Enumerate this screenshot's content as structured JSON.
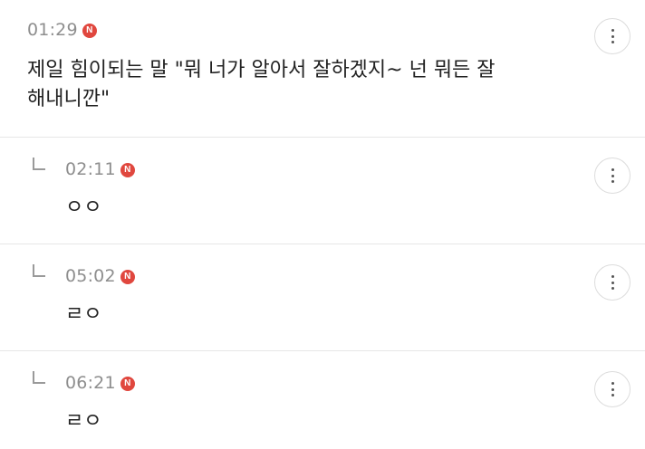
{
  "comments": [
    {
      "time": "01:29",
      "badge": "N",
      "text_line1": "제일 힘이되는 말 \"뭐 너가 알아서 잘하겠지~ 넌 뭐든 잘",
      "text_line2": "해내니깐\"",
      "is_reply": false
    },
    {
      "time": "02:11",
      "badge": "N",
      "text": "ㅇㅇ",
      "is_reply": true
    },
    {
      "time": "05:02",
      "badge": "N",
      "text": "ㄹㅇ",
      "is_reply": true
    },
    {
      "time": "06:21",
      "badge": "N",
      "text": "ㄹㅇ",
      "is_reply": true
    }
  ],
  "icons": {
    "more": "more-vertical-icon",
    "reply": "reply-arrow-icon"
  },
  "colors": {
    "badge": "#e0473e",
    "time": "#8e8e8e",
    "divider": "#e6e6e6"
  }
}
